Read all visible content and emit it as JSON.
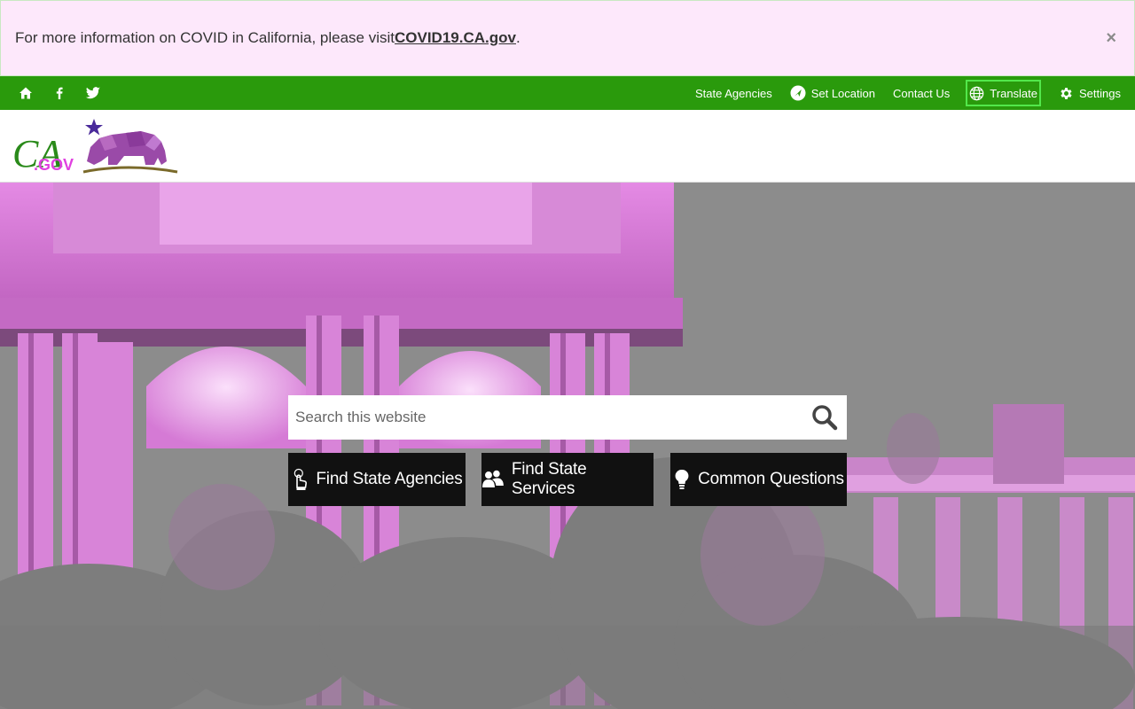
{
  "alert": {
    "text": "For more information on COVID in California, please visit ",
    "link_text": "COVID19.CA.gov",
    "suffix": ".",
    "close_label": "×"
  },
  "utility_bar": {
    "social_icons": [
      "home-icon",
      "facebook-icon",
      "twitter-icon"
    ],
    "state_agencies": "State Agencies",
    "set_location": "Set Location",
    "contact_us": "Contact Us",
    "translate": "Translate",
    "settings": "Settings",
    "bg_color": "#2a9a0c"
  },
  "header": {
    "logo_text": "CA.GOV",
    "logo_prefix": "CA",
    "logo_suffix": ".GOV"
  },
  "hero": {
    "search_placeholder": "Search this website",
    "buttons": [
      {
        "label": "Find State Agencies",
        "icon": "pointer-hand-icon"
      },
      {
        "label": "Find State Services",
        "icon": "people-icon"
      },
      {
        "label": "Common Questions",
        "icon": "lightbulb-icon"
      }
    ]
  },
  "colors": {
    "alert_bg": "#fde8fb",
    "accent_green": "#2a9a0c",
    "hero_tint": "#e08fe0"
  }
}
